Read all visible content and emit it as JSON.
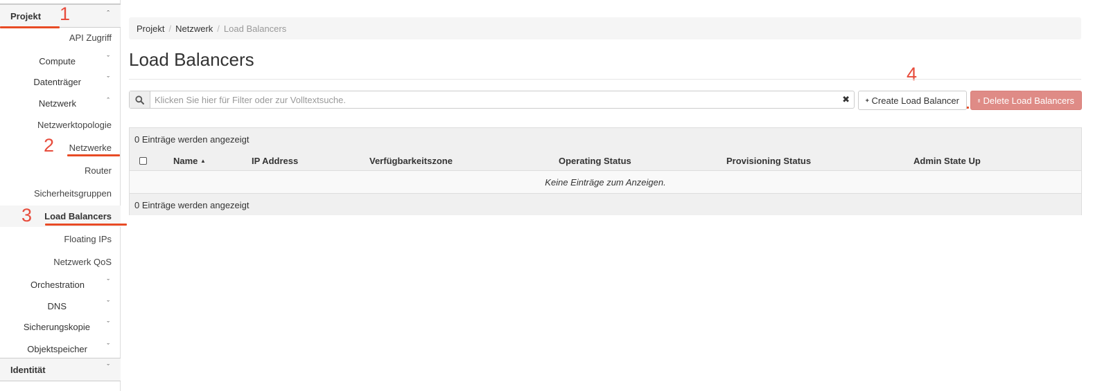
{
  "sidebar": {
    "sections": {
      "projekt": "Projekt",
      "identitaet": "Identität"
    },
    "items": {
      "api_zugriff": "API Zugriff",
      "compute": "Compute",
      "datentraeger": "Datenträger",
      "netzwerk": "Netzwerk",
      "netzwerktopologie": "Netzwerktopologie",
      "netzwerke": "Netzwerke",
      "router": "Router",
      "sicherheitsgruppen": "Sicherheitsgruppen",
      "load_balancers": "Load Balancers",
      "floating_ips": "Floating IPs",
      "netzwerk_qos": "Netzwerk QoS",
      "orchestration": "Orchestration",
      "dns": "DNS",
      "sicherungskopie": "Sicherungskopie",
      "objektspeicher": "Objektspeicher"
    },
    "chevron_up": "ˆ",
    "chevron_down": "ˇ"
  },
  "annotations": {
    "n1": "1",
    "n2": "2",
    "n3": "3",
    "n4": "4",
    "color": "#e84b25"
  },
  "breadcrumb": {
    "items": [
      "Projekt",
      "Netzwerk",
      "Load Balancers"
    ],
    "separator": "/"
  },
  "page": {
    "title": "Load Balancers"
  },
  "search": {
    "placeholder": "Klicken Sie hier für Filter oder zur Volltextsuche.",
    "clear_glyph": "✖"
  },
  "actions": {
    "create_label": "Create Load Balancer",
    "delete_label": "Delete Load Balancers",
    "delete_color": "#df8b86"
  },
  "table": {
    "count_text": "0 Einträge werden angezeigt",
    "columns": [
      "Name",
      "IP Address",
      "Verfügbarkeitszone",
      "Operating Status",
      "Provisioning Status",
      "Admin State Up"
    ],
    "sort_glyph": "▲",
    "empty_text": "Keine Einträge zum Anzeigen."
  }
}
